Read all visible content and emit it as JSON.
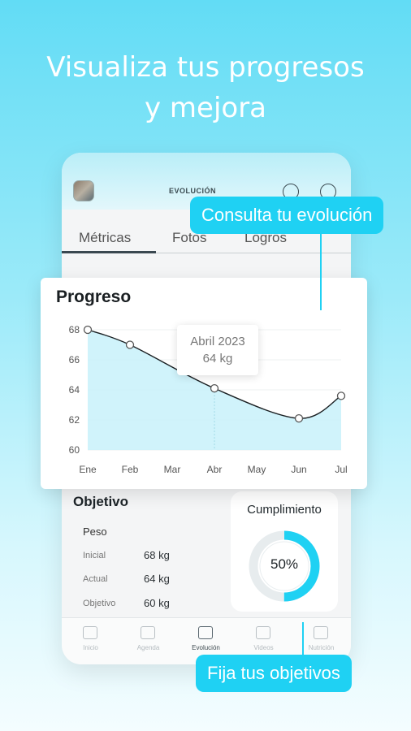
{
  "headline": {
    "line1": "Visualiza  tus progresos",
    "line2": "y mejora"
  },
  "app": {
    "screen_title": "EVOLUCIÓN",
    "tabs": [
      "Métricas",
      "Fotos",
      "Logros"
    ],
    "active_tab": "Métricas"
  },
  "progress_card": {
    "title": "Progreso",
    "tooltip": {
      "date": "Abril 2023",
      "value": "64 kg"
    }
  },
  "chart_data": {
    "type": "line",
    "categories": [
      "Ene",
      "Feb",
      "Mar",
      "Abr",
      "May",
      "Jun",
      "Jul"
    ],
    "series": [
      {
        "x": [
          "Ene",
          "Feb",
          "Abr",
          "Jun",
          "Jul"
        ],
        "values": [
          68,
          67,
          64.1,
          62.1,
          63.6
        ]
      }
    ],
    "yticks": [
      60,
      62,
      64,
      66,
      68
    ],
    "ylim": [
      60,
      68
    ],
    "grid": true,
    "fill": true,
    "colors": {
      "line": "#1a1f22",
      "fill": "#c8f1fa",
      "marker": "#ffffff"
    }
  },
  "objetivo": {
    "title": "Objetivo",
    "peso_label": "Peso",
    "rows": [
      {
        "label": "Inicial",
        "value": "68 kg"
      },
      {
        "label": "Actual",
        "value": "64 kg"
      },
      {
        "label": "Objetivo",
        "value": "60 kg"
      }
    ]
  },
  "cumplimiento": {
    "title": "Cumplimiento",
    "percent_text": "50%",
    "percent": 0.5
  },
  "nav": [
    "Inicio",
    "Agenda",
    "Evolución",
    "Videos",
    "Nutrición"
  ],
  "callouts": {
    "top": "Consulta tu evolución",
    "bottom": "Fija tus objetivos"
  },
  "colors": {
    "accent": "#1fd1f3",
    "background": "#62dcf5"
  }
}
